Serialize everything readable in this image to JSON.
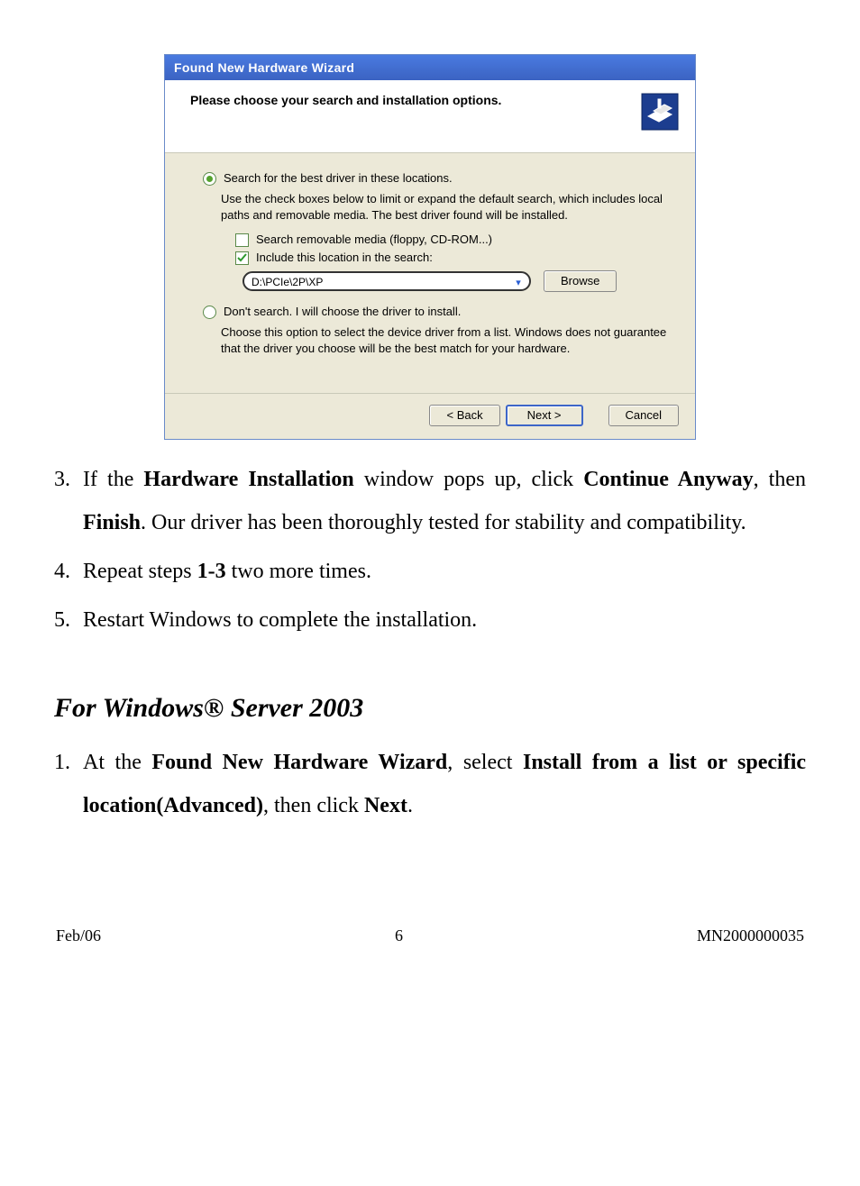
{
  "wizard": {
    "title": "Found New Hardware Wizard",
    "header": "Please choose your search and installation options.",
    "opt1": {
      "label": "Search for the best driver in these locations.",
      "desc": "Use the check boxes below to limit or expand the default search, which includes local paths and removable media. The best driver found will be installed.",
      "check_removable": "Search removable media (floppy, CD-ROM...)",
      "check_include": "Include this location in the search:",
      "path": "D:\\PCIe\\2P\\XP",
      "browse": "Browse"
    },
    "opt2": {
      "label": "Don't search. I will choose the driver to install.",
      "desc": "Choose this option to select the device driver from a list.  Windows does not guarantee that the driver you choose will be the best match for your hardware."
    },
    "buttons": {
      "back": "< Back",
      "next": "Next >",
      "cancel": "Cancel"
    }
  },
  "doc": {
    "item3": {
      "num": "3.",
      "pre": "If the ",
      "b1": "Hardware Installation",
      "mid1": " window pops up, click ",
      "b2": "Continue Anyway",
      "mid2": ", then ",
      "b3": "Finish",
      "post": ". Our driver has been thoroughly tested for stability and compatibility."
    },
    "item4": {
      "num": "4.",
      "pre": "Repeat steps ",
      "b1": "1-3",
      "post": " two more times."
    },
    "item5": {
      "num": "5.",
      "text": "Restart Windows to complete the installation."
    },
    "section": "For Windows® Server 2003",
    "s1": {
      "num": "1.",
      "pre": "At the ",
      "b1": "Found New Hardware Wizard",
      "mid1": ", select ",
      "b2": "Install from a list or specific location(Advanced)",
      "mid2": ", then click ",
      "b3": "Next",
      "post": "."
    }
  },
  "footer": {
    "left": "Feb/06",
    "center": "6",
    "right": "MN2000000035"
  }
}
